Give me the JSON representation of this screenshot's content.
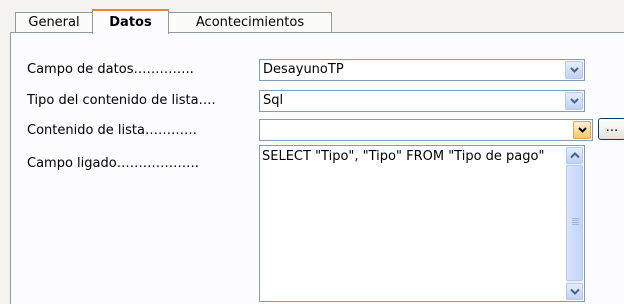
{
  "tabs": [
    "General",
    "Datos",
    "Acontecimientos"
  ],
  "active_tab": "Datos",
  "fields": {
    "campo_datos": {
      "label": "Campo de datos…………..",
      "value": "DesayunoTP"
    },
    "tipo_contenido": {
      "label": "Tipo del contenido de lista….",
      "value": "Sql"
    },
    "contenido_lista": {
      "label": "Contenido de lista…………",
      "value": ""
    },
    "campo_ligado": {
      "label": "Campo ligado………………."
    }
  },
  "sql_text": "SELECT \"Tipo\", \"Tipo\" FROM \"Tipo de pago\"",
  "dots_label": "...",
  "icons": {
    "dropdown": "chevron-down-icon",
    "scroll_up": "chevron-up-icon",
    "scroll_down": "chevron-down-icon"
  }
}
